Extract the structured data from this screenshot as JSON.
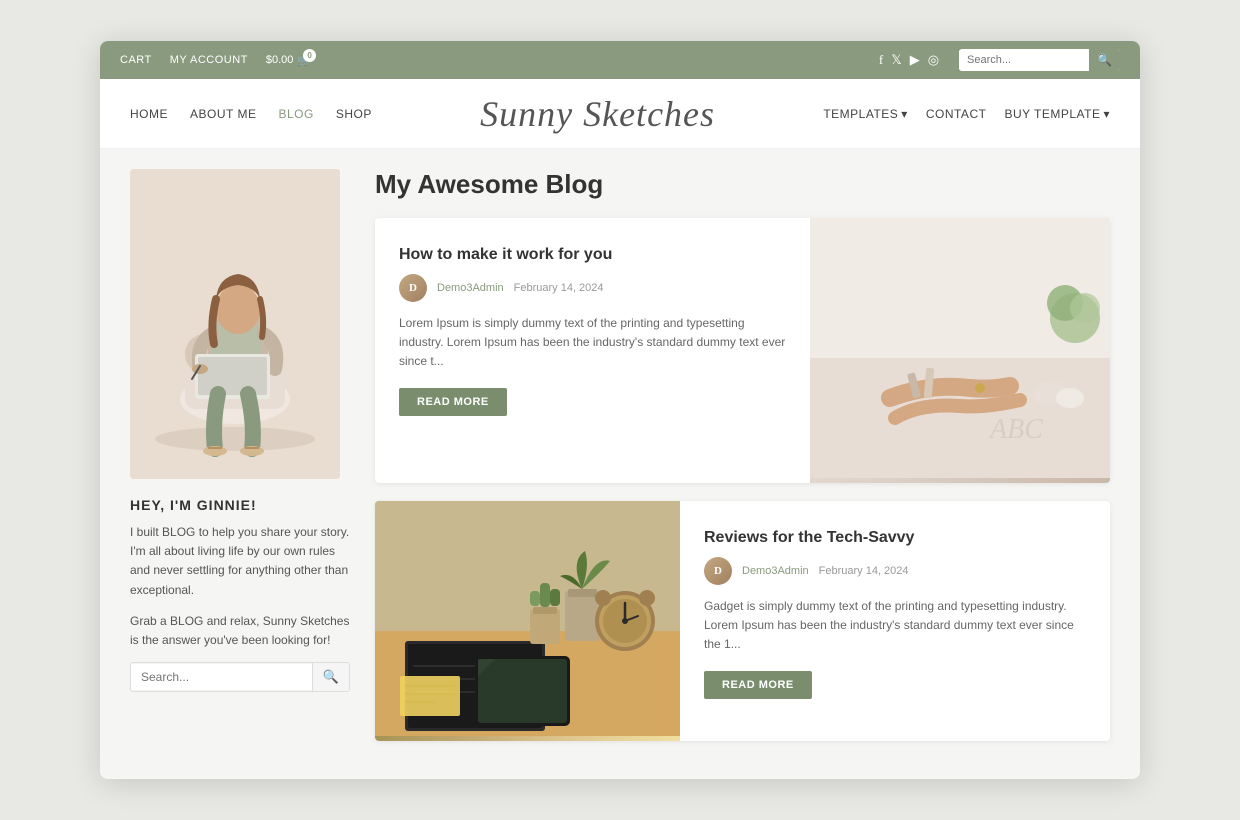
{
  "topbar": {
    "cart_label": "CART",
    "account_label": "MY ACCOUNT",
    "price_label": "$0.00",
    "cart_count": "0",
    "search_placeholder": "Search...",
    "social": [
      "facebook",
      "twitter",
      "youtube",
      "instagram"
    ]
  },
  "nav": {
    "logo": "Sunny Sketches",
    "left_links": [
      {
        "label": "HOME",
        "active": false
      },
      {
        "label": "ABOUT ME",
        "active": false
      },
      {
        "label": "BLOG",
        "active": true
      },
      {
        "label": "SHOP",
        "active": false
      }
    ],
    "right_links": [
      {
        "label": "TEMPLATES",
        "dropdown": true
      },
      {
        "label": "CONTACT",
        "dropdown": false
      },
      {
        "label": "BUY TEMPLATE",
        "dropdown": true
      }
    ]
  },
  "sidebar": {
    "heading": "HEY, I'M GINNIE!",
    "text1": "I built BLOG to help you share your story. I'm all about living life by our own rules and never settling for anything other than exceptional.",
    "text2": "Grab a BLOG and relax, Sunny Sketches is the answer you've been looking for!",
    "search_placeholder": "Search..."
  },
  "blog": {
    "title": "My Awesome Blog",
    "posts": [
      {
        "title": "How to make it work for you",
        "author": "Demo3Admin",
        "date": "February 14, 2024",
        "excerpt": "Lorem Ipsum is simply dummy text of the printing and typesetting industry. Lorem Ipsum has been the industry's standard dummy text ever since t...",
        "read_more": "READ MORE"
      },
      {
        "title": "Reviews for the Tech-Savvy",
        "author": "Demo3Admin",
        "date": "February 14, 2024",
        "excerpt": "Gadget  is simply dummy text of the printing and typesetting industry. Lorem Ipsum has been the industry's standard dummy text ever since the 1...",
        "read_more": "READ MORE"
      }
    ]
  }
}
